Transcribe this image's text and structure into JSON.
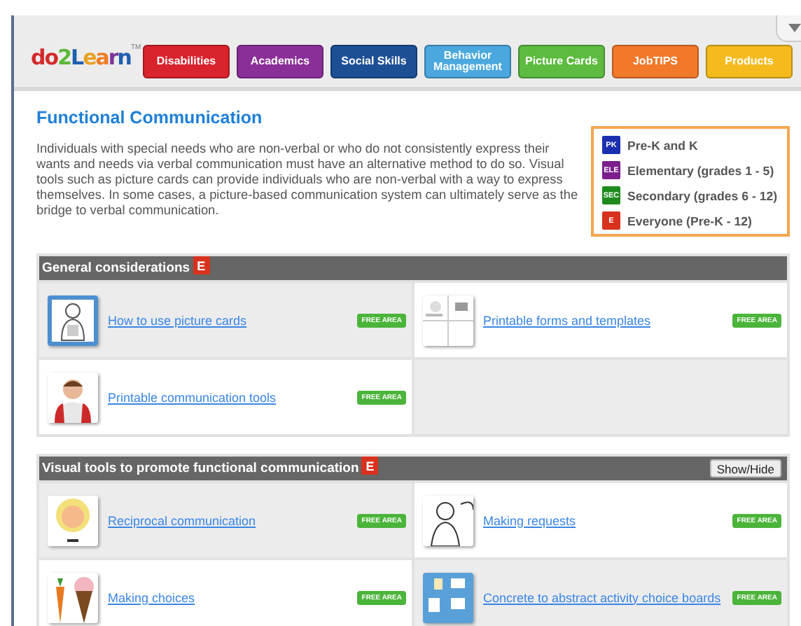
{
  "logo": {
    "text": "do2Learn",
    "mark": "TM"
  },
  "nav": [
    {
      "label": "Disabilities",
      "color": "#d9232d"
    },
    {
      "label": "Academics",
      "color": "#8a2f98"
    },
    {
      "label": "Social Skills",
      "color": "#1d4f95"
    },
    {
      "label": "Behavior Management",
      "color": "#4aa8de"
    },
    {
      "label": "Picture Cards",
      "color": "#5dbb3f"
    },
    {
      "label": "JobTIPS",
      "color": "#f2782a"
    },
    {
      "label": "Products",
      "color": "#f5bb1e"
    }
  ],
  "title": "Functional Communication",
  "intro": "Individuals with special needs who are non-verbal or who do not consistently express their wants and needs via verbal communication must have an alternative method to do so.  Visual tools such as picture cards can provide individuals who are non-verbal with a way to express themselves.   In some cases, a picture-based communication system can ultimately serve as the bridge to verbal communication.",
  "legend": [
    {
      "badge": "PK",
      "label": "Pre-K and K",
      "color": "#1a2fb0"
    },
    {
      "badge": "ELE",
      "label": "Elementary (grades 1 - 5)",
      "color": "#7a1f8c"
    },
    {
      "badge": "SEC",
      "label": "Secondary (grades 6 - 12)",
      "color": "#1e8a1e"
    },
    {
      "badge": "E",
      "label": "Everyone (Pre-K - 12)",
      "color": "#d8321e"
    }
  ],
  "sections": [
    {
      "title": "General considerations",
      "badge": "E",
      "items": [
        {
          "link": "How to use picture cards",
          "tag": "FREE AREA"
        },
        {
          "link": "Printable forms and templates",
          "tag": "FREE AREA"
        },
        {
          "link": "Printable communication tools",
          "tag": "FREE AREA"
        }
      ]
    },
    {
      "title": "Visual tools to promote functional communication",
      "badge": "E",
      "toggle": "Show/Hide",
      "items": [
        {
          "link": "Reciprocal communication",
          "tag": "FREE AREA"
        },
        {
          "link": "Making requests",
          "tag": "FREE AREA"
        },
        {
          "link": "Making choices ",
          "tag": "FREE AREA"
        },
        {
          "link": "Concrete to abstract activity choice boards",
          "tag": "FREE AREA"
        }
      ]
    }
  ]
}
